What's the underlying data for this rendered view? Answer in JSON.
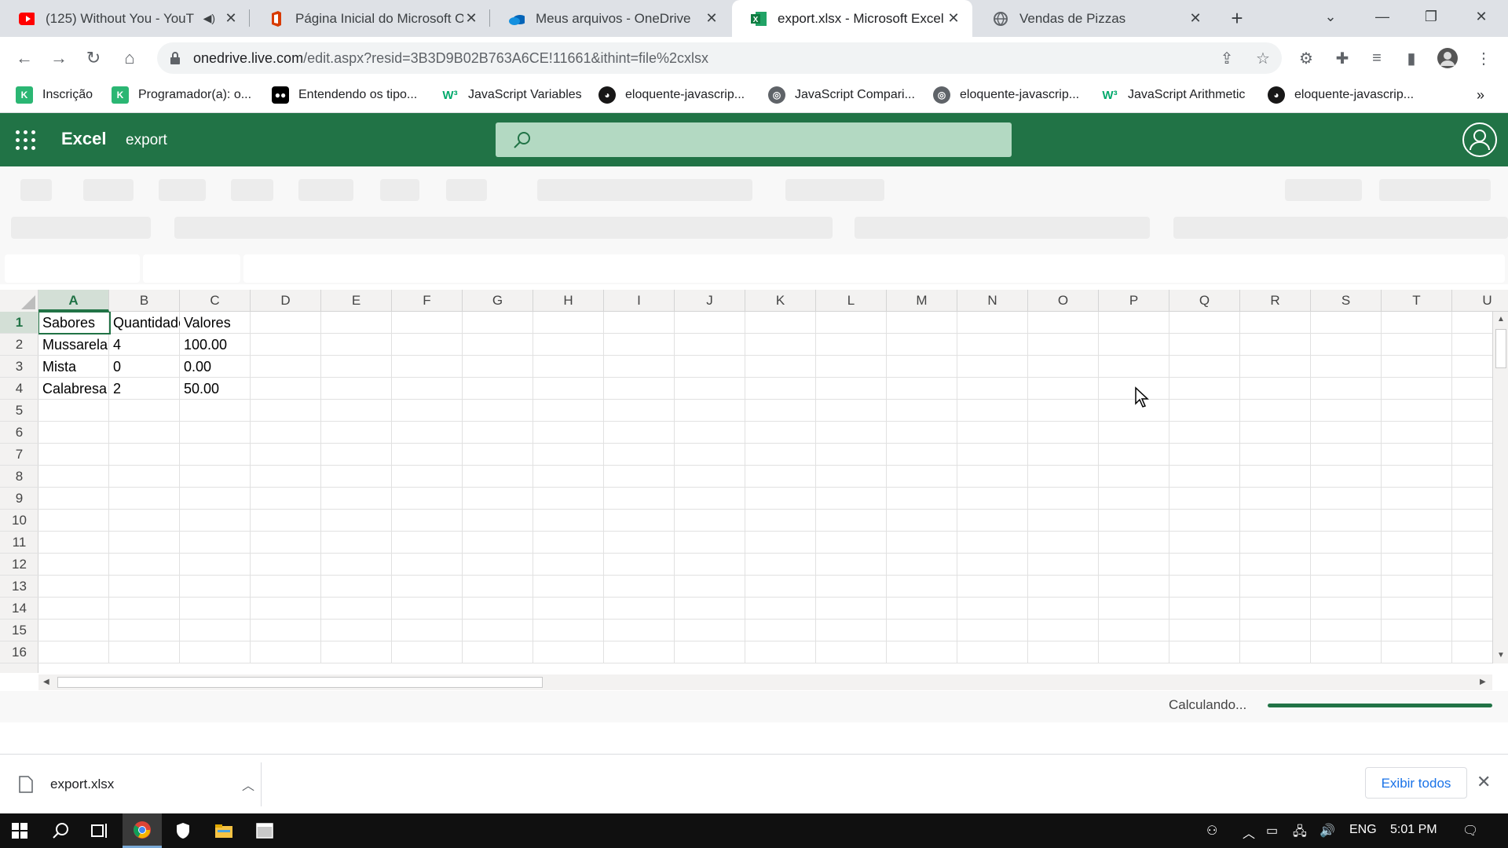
{
  "browser": {
    "tabs": [
      {
        "title": "(125) Without You - YouT",
        "favicon": "youtube-icon",
        "muted_icon": "speaker-icon",
        "active": false
      },
      {
        "title": "Página Inicial do Microsoft O",
        "favicon": "office-icon",
        "active": false
      },
      {
        "title": "Meus arquivos - OneDrive",
        "favicon": "onedrive-icon",
        "active": false
      },
      {
        "title": "export.xlsx - Microsoft Excel",
        "favicon": "excel-icon",
        "active": true
      },
      {
        "title": "Vendas de Pizzas",
        "favicon": "globe-icon",
        "active": false
      }
    ],
    "address": {
      "host": "onedrive.live.com",
      "path": "/edit.aspx?resid=3B3D9B02B763A6CE!11661&ithint=file%2cxlsx"
    },
    "bookmarks": [
      {
        "label": "Inscrição",
        "icon": "k-icon"
      },
      {
        "label": "Programador(a): o...",
        "icon": "k-icon"
      },
      {
        "label": "Entendendo os tipo...",
        "icon": "video-icon"
      },
      {
        "label": "JavaScript Variables",
        "icon": "w3-icon"
      },
      {
        "label": "eloquente-javascrip...",
        "icon": "github-icon"
      },
      {
        "label": "JavaScript Compari...",
        "icon": "globe-icon"
      },
      {
        "label": "eloquente-javascrip...",
        "icon": "globe-icon"
      },
      {
        "label": "JavaScript Arithmetic",
        "icon": "w3-icon"
      },
      {
        "label": "eloquente-javascrip...",
        "icon": "github-icon"
      }
    ],
    "bookmarks_overflow": "»"
  },
  "excel": {
    "app_name": "Excel",
    "doc_name": "export",
    "columns": [
      "A",
      "B",
      "C",
      "D",
      "E",
      "F",
      "G",
      "H",
      "I",
      "J",
      "K",
      "L",
      "M",
      "N",
      "O",
      "P",
      "Q",
      "R",
      "S",
      "T",
      "U"
    ],
    "rows": [
      "1",
      "2",
      "3",
      "4",
      "5",
      "6",
      "7",
      "8",
      "9",
      "10",
      "11",
      "12",
      "13",
      "14",
      "15",
      "16"
    ],
    "cells": [
      [
        "Sabores",
        "Quantidade",
        "Valores"
      ],
      [
        "Mussarela",
        "4",
        "100.00"
      ],
      [
        "Mista",
        "0",
        "0.00"
      ],
      [
        "Calabresa",
        "2",
        "50.00"
      ]
    ],
    "status_text": "Calculando...",
    "accent": "#217346"
  },
  "downloads": {
    "file": "export.xlsx",
    "show_all": "Exibir todos"
  },
  "taskbar": {
    "language": "ENG",
    "time": "5:01 PM"
  }
}
